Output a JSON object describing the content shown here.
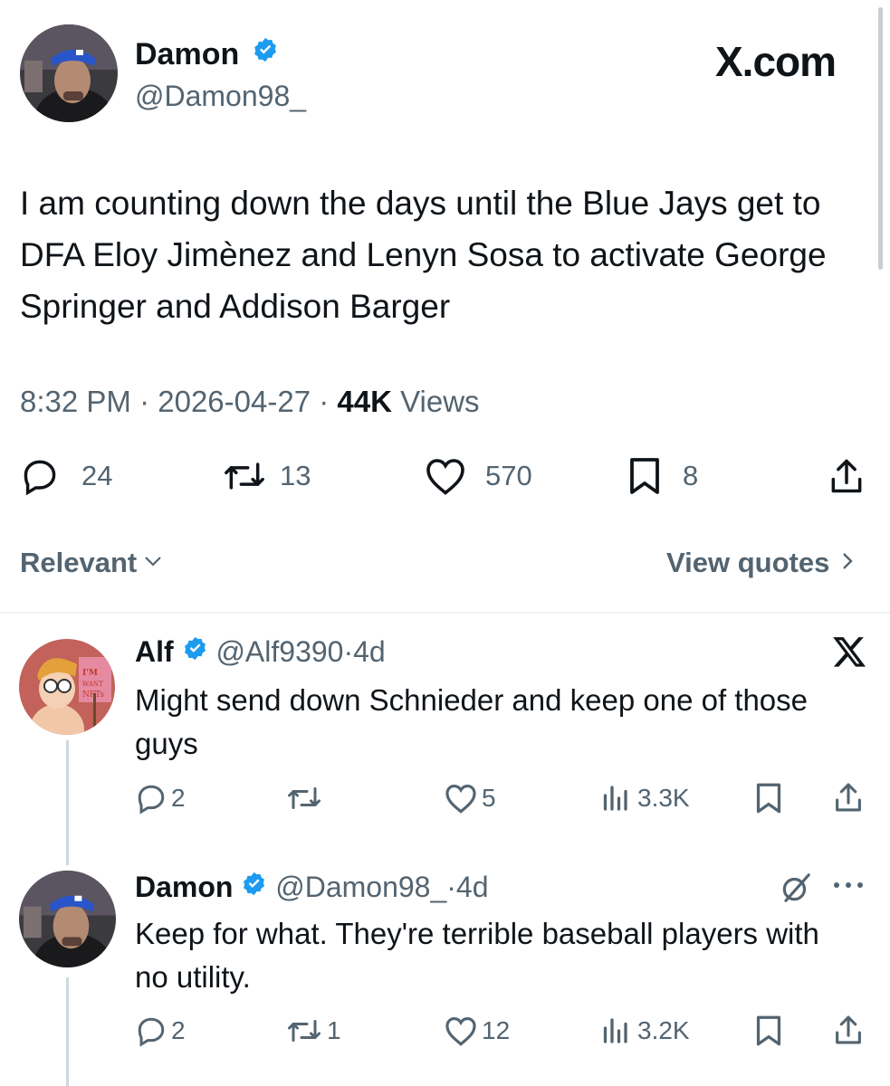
{
  "main_tweet": {
    "display_name": "Damon",
    "handle": "@Damon98_",
    "watermark": "X.com",
    "text": "I am counting down the days until the Blue Jays get to DFA Eloy Jimènez and Lenyn Sosa to activate George Springer and Addison Barger",
    "time": "8:32 PM",
    "date": "2026-04-27",
    "views_count": "44K",
    "views_label": "Views",
    "separator": "·",
    "replies": "24",
    "reposts": "13",
    "likes": "570",
    "bookmarks": "8"
  },
  "filters": {
    "sort_label": "Relevant",
    "view_quotes_label": "View quotes"
  },
  "replies": [
    {
      "display_name": "Alf",
      "handle": "@Alf9390",
      "age": "4d",
      "text": "Might send down Schnieder and keep one of those guys",
      "replies": "2",
      "reposts": "",
      "likes": "5",
      "views": "3.3K",
      "avatar_sign_text": "I'M HAPPY I WANT NFTS"
    },
    {
      "display_name": "Damon",
      "handle": "@Damon98_",
      "age": "4d",
      "text": "Keep for what. They're terrible baseball players with no utility.",
      "replies": "2",
      "reposts": "1",
      "likes": "12",
      "views": "3.2K"
    }
  ],
  "colors": {
    "text": "#0f1419",
    "muted": "#536471",
    "verified": "#1d9bf0",
    "divider": "#eff3f4"
  }
}
